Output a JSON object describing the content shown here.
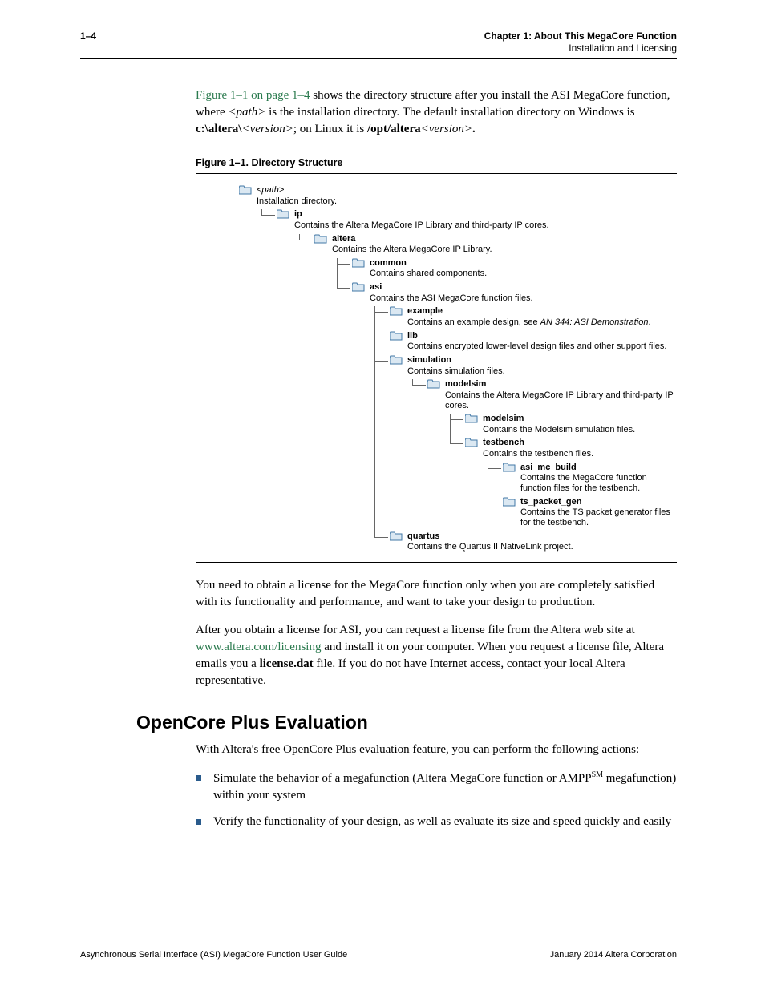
{
  "header": {
    "page_number": "1–4",
    "chapter_line": "Chapter 1: About This MegaCore Function",
    "sub_line": "Installation and Licensing"
  },
  "intro_para": {
    "figref": "Figure 1–1 on page 1–4",
    "t1": " shows the directory structure after you install the ASI MegaCore function, where ",
    "path_ital": "<path>",
    "t2": " is the installation directory. The default installation directory on Windows is ",
    "winpath_a": "c:\\altera\\",
    "winpath_b": "<version>",
    "t3": "; on Linux it is ",
    "linuxpath_a": "/opt/altera",
    "linuxpath_b": "<version>",
    "period": "."
  },
  "figure": {
    "caption": "Figure 1–1. Directory Structure",
    "tree": {
      "path_label": "<path>",
      "path_desc": "Installation directory.",
      "ip_label": "ip",
      "ip_desc": "Contains the Altera MegaCore IP Library and third-party IP cores.",
      "altera_label": "altera",
      "altera_desc": "Contains the Altera MegaCore IP Library.",
      "common_label": "common",
      "common_desc": "Contains shared components.",
      "asi_label": "asi",
      "asi_desc": "Contains the ASI MegaCore function files.",
      "example_label": "example",
      "example_desc_a": "Contains an example design, see ",
      "example_desc_b": "AN 344: ASI Demonstration",
      "example_desc_c": ".",
      "lib_label": "lib",
      "lib_desc": "Contains encrypted lower-level design files and other support files.",
      "sim_label": "simulation",
      "sim_desc": "Contains simulation files.",
      "ms1_label": "modelsim",
      "ms1_desc": "Contains the Altera MegaCore IP Library and third-party IP cores.",
      "ms2_label": "modelsim",
      "ms2_desc": "Contains the Modelsim simulation files.",
      "tb_label": "testbench",
      "tb_desc": "Contains the testbench files.",
      "mcb_label": "asi_mc_build",
      "mcb_desc": "Contains the MegaCore function function files for the testbench.",
      "tsp_label": "ts_packet_gen",
      "tsp_desc": "Contains the TS packet generator files for the testbench.",
      "quartus_label": "quartus",
      "quartus_desc": "Contains the Quartus II NativeLink project."
    }
  },
  "para2": "You need to obtain a license for the MegaCore function only when you are completely satisfied with its functionality and performance, and want to take your design to production.",
  "para3": {
    "a": "After you obtain a license for ASI, you can request a license file from the Altera web site at ",
    "link": "www.altera.com/licensing",
    "b": " and install it on your computer. When you request a license file, Altera emails you a ",
    "bold": "license.dat",
    "c": " file. If you do not have Internet access, contact your local Altera representative."
  },
  "section_heading": "OpenCore Plus Evaluation",
  "para4": "With Altera's free OpenCore Plus evaluation feature, you can perform the following actions:",
  "bullets": {
    "b1a": "Simulate the behavior of a megafunction (Altera MegaCore function or AMPP",
    "b1_sup": "SM",
    "b1b": " megafunction) within your system",
    "b2": "Verify the functionality of your design, as well as evaluate its size and speed quickly and easily"
  },
  "footer": {
    "left": "Asynchronous Serial Interface (ASI) MegaCore Function User Guide",
    "right": "January 2014   Altera Corporation"
  }
}
